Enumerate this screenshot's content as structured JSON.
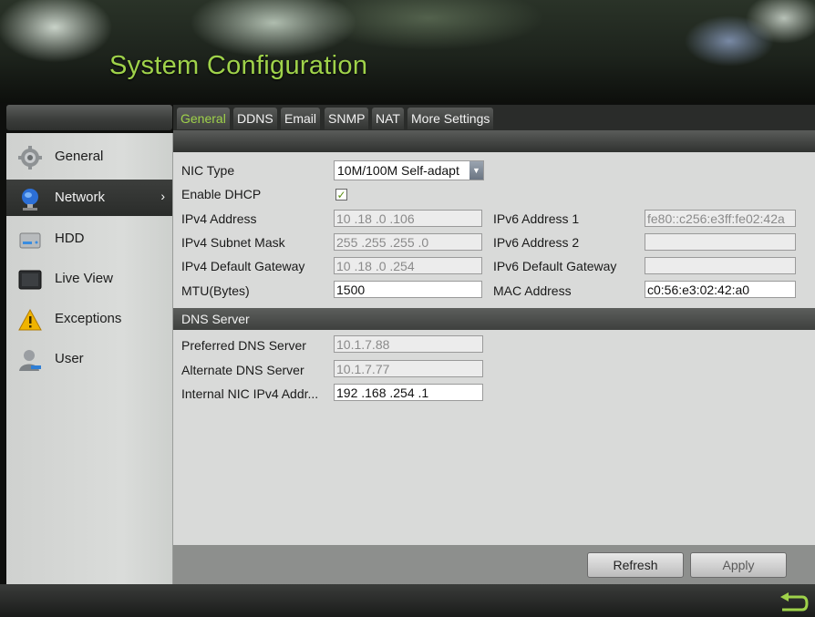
{
  "window": {
    "title": "System Configuration"
  },
  "sidebar": {
    "items": [
      {
        "label": "General",
        "icon": "gear-icon"
      },
      {
        "label": "Network",
        "icon": "globe-icon",
        "active": true,
        "arrow": "›"
      },
      {
        "label": "HDD",
        "icon": "hard-drive-icon"
      },
      {
        "label": "Live View",
        "icon": "monitor-icon"
      },
      {
        "label": "Exceptions",
        "icon": "warning-icon"
      },
      {
        "label": "User",
        "icon": "user-icon"
      }
    ]
  },
  "tabs": [
    {
      "label": "General",
      "active": true
    },
    {
      "label": "DDNS"
    },
    {
      "label": "Email"
    },
    {
      "label": "SNMP"
    },
    {
      "label": "NAT"
    },
    {
      "label": "More Settings"
    }
  ],
  "general": {
    "nic_type": {
      "label": "NIC Type",
      "value": "10M/100M Self-adapt",
      "dropdown_icon": "▼"
    },
    "enable_dhcp": {
      "label": "Enable DHCP",
      "checked": true,
      "check_mark": "✓"
    },
    "ipv4_address": {
      "label": "IPv4 Address",
      "value": "10   .18   .0     .106"
    },
    "ipv4_subnet_mask": {
      "label": "IPv4 Subnet Mask",
      "value": "255 .255 .255 .0"
    },
    "ipv4_default_gateway": {
      "label": "IPv4 Default Gateway",
      "value": "10   .18   .0     .254"
    },
    "mtu": {
      "label": "MTU(Bytes)",
      "value": "1500"
    },
    "ipv6_address_1": {
      "label": "IPv6 Address 1",
      "value": "fe80::c256:e3ff:fe02:42a"
    },
    "ipv6_address_2": {
      "label": "IPv6 Address 2",
      "value": ""
    },
    "ipv6_default_gateway": {
      "label": "IPv6 Default Gateway",
      "value": ""
    },
    "mac_address": {
      "label": "MAC Address",
      "value": "c0:56:e3:02:42:a0"
    }
  },
  "dns": {
    "section_title": "DNS Server",
    "preferred": {
      "label": "Preferred DNS Server",
      "value": "10.1.7.88"
    },
    "alternate": {
      "label": "Alternate DNS Server",
      "value": "10.1.7.77"
    },
    "internal_nic": {
      "label": "Internal NIC IPv4 Addr...",
      "value": "192 .168 .254 .1"
    }
  },
  "buttons": {
    "refresh": "Refresh",
    "apply": "Apply"
  },
  "footer": {
    "back_icon": "back-arrow-icon"
  },
  "colors": {
    "accent": "#9fd24a",
    "panel": "#d9dad9",
    "sidebar_active": "#2f312f"
  }
}
